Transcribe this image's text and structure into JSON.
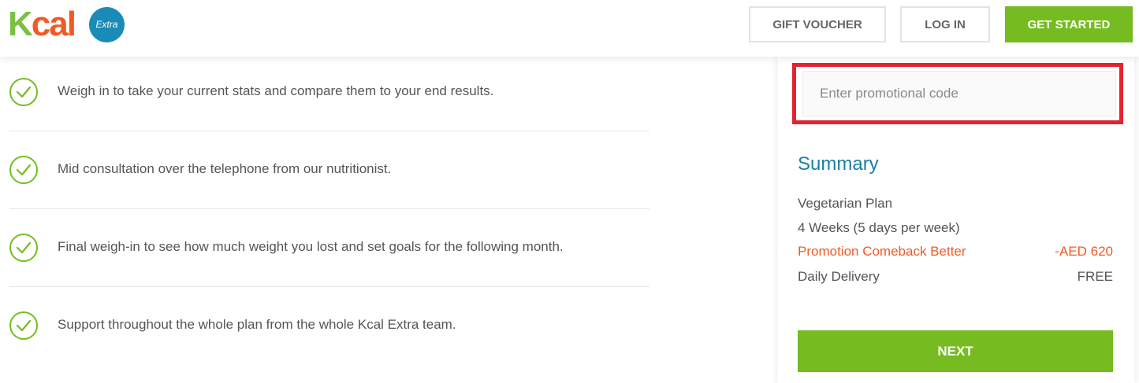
{
  "header": {
    "logo": {
      "text_primary_k": "K",
      "text_primary_rest": "cal",
      "badge": "Extra"
    },
    "buttons": {
      "gift_voucher": "GIFT VOUCHER",
      "log_in": "LOG IN",
      "get_started": "GET STARTED"
    }
  },
  "features": [
    {
      "text": "Weigh in to take your current stats and compare them to your end results."
    },
    {
      "text": "Mid consultation over the telephone from our nutritionist."
    },
    {
      "text": "Final weigh-in to see how much weight you lost and set goals for the following month."
    },
    {
      "text": "Support throughout the whole plan from the whole Kcal Extra team."
    }
  ],
  "promo": {
    "placeholder": "Enter promotional code",
    "value": ""
  },
  "summary": {
    "title": "Summary",
    "plan": "Vegetarian Plan",
    "duration": "4 Weeks (5 days per week)",
    "promotion_label": "Promotion Comeback Better",
    "promotion_value": "-AED 620",
    "delivery_label": "Daily Delivery",
    "delivery_value": "FREE"
  },
  "next_label": "NEXT",
  "colors": {
    "green": "#76bc21",
    "orange": "#f15a24",
    "blue": "#1a7fa6",
    "highlight_red": "#e3232e"
  }
}
